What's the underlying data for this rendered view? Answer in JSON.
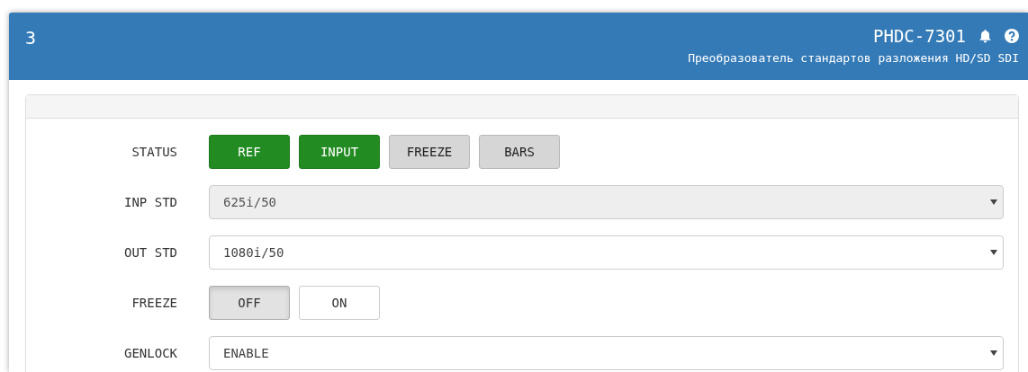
{
  "header": {
    "number": "3",
    "device": "PHDC-7301",
    "subtitle": "Преобразователь стандартов разложения HD/SD SDI"
  },
  "rows": [
    {
      "kind": "indicators",
      "label": "STATUS",
      "items": [
        {
          "label": "REF",
          "on": true
        },
        {
          "label": "INPUT",
          "on": true
        },
        {
          "label": "FREEZE",
          "on": false
        },
        {
          "label": "BARS",
          "on": false
        }
      ]
    },
    {
      "kind": "select",
      "label": "INP STD",
      "value": "625i/50",
      "disabled": true
    },
    {
      "kind": "select",
      "label": "OUT STD",
      "value": "1080i/50",
      "disabled": false
    },
    {
      "kind": "toggle",
      "label": "FREEZE",
      "options": [
        {
          "label": "OFF",
          "selected": true
        },
        {
          "label": "ON",
          "selected": false
        }
      ]
    },
    {
      "kind": "select",
      "label": "GENLOCK",
      "value": "ENABLE",
      "disabled": false
    }
  ]
}
